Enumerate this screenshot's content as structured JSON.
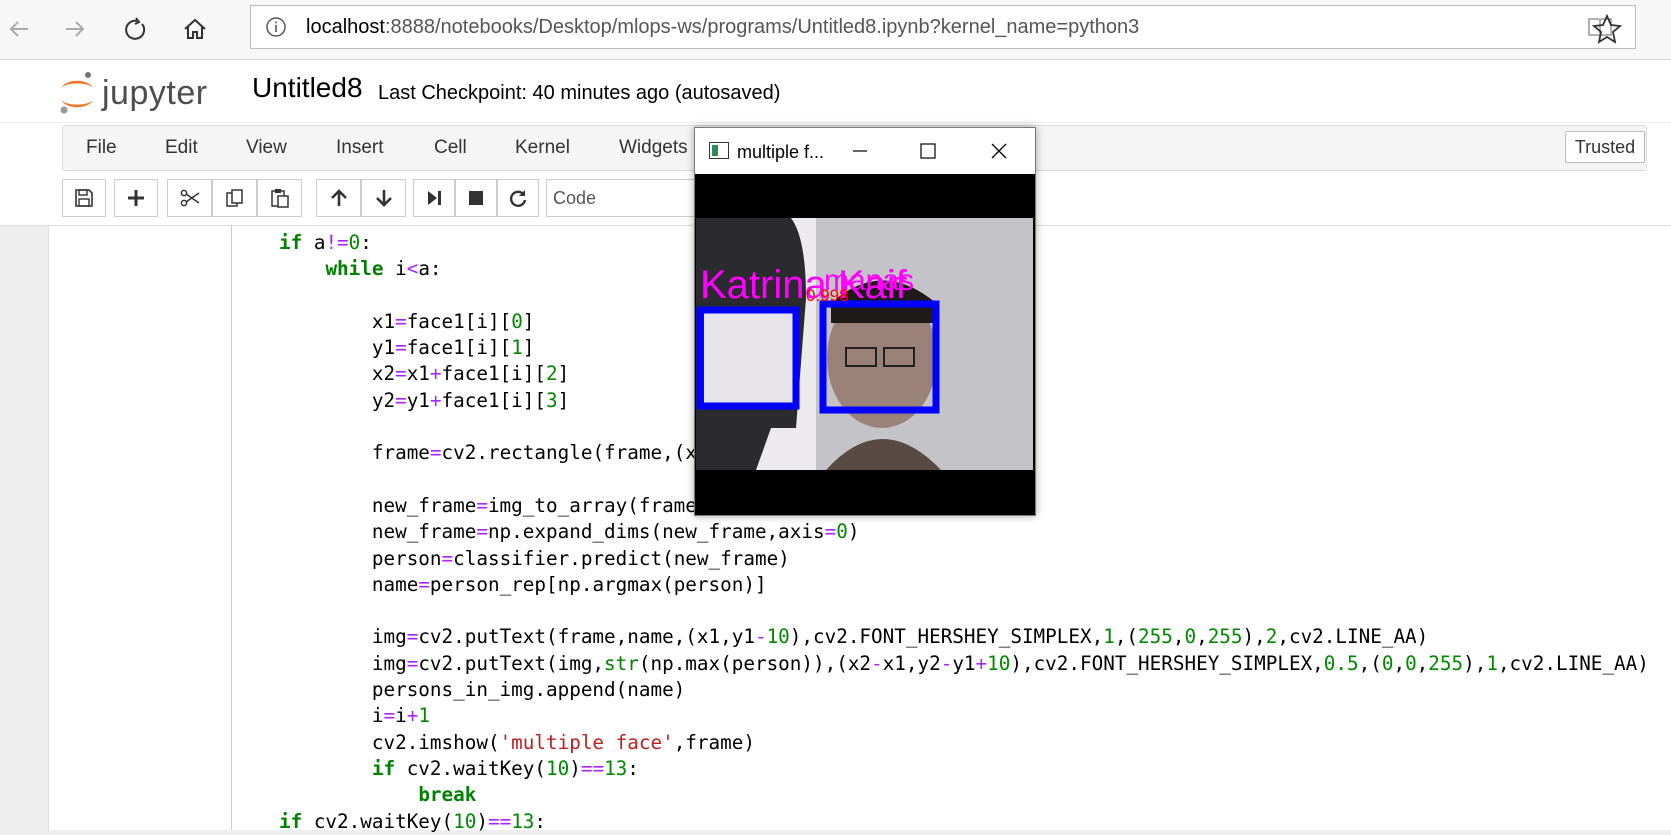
{
  "browser": {
    "url_host": "localhost",
    "url_rest": ":8888/notebooks/Desktop/mlops-ws/programs/Untitled8.ipynb?kernel_name=python3"
  },
  "header": {
    "logo_text": "jupyter",
    "notebook_name": "Untitled8",
    "checkpoint": "Last Checkpoint: 40 minutes ago (autosaved)"
  },
  "menu": {
    "items": [
      "File",
      "Edit",
      "View",
      "Insert",
      "Cell",
      "Kernel",
      "Widgets"
    ],
    "trusted": "Trusted"
  },
  "toolbar": {
    "cell_type": "Code"
  },
  "popup": {
    "title": "multiple f...",
    "label_left": "Katrina Kaif",
    "label_right": "manas",
    "score_text": "0.998"
  },
  "colors": {
    "box": "#0000ff",
    "label": "#ff00ff",
    "score": "#ff0000"
  }
}
